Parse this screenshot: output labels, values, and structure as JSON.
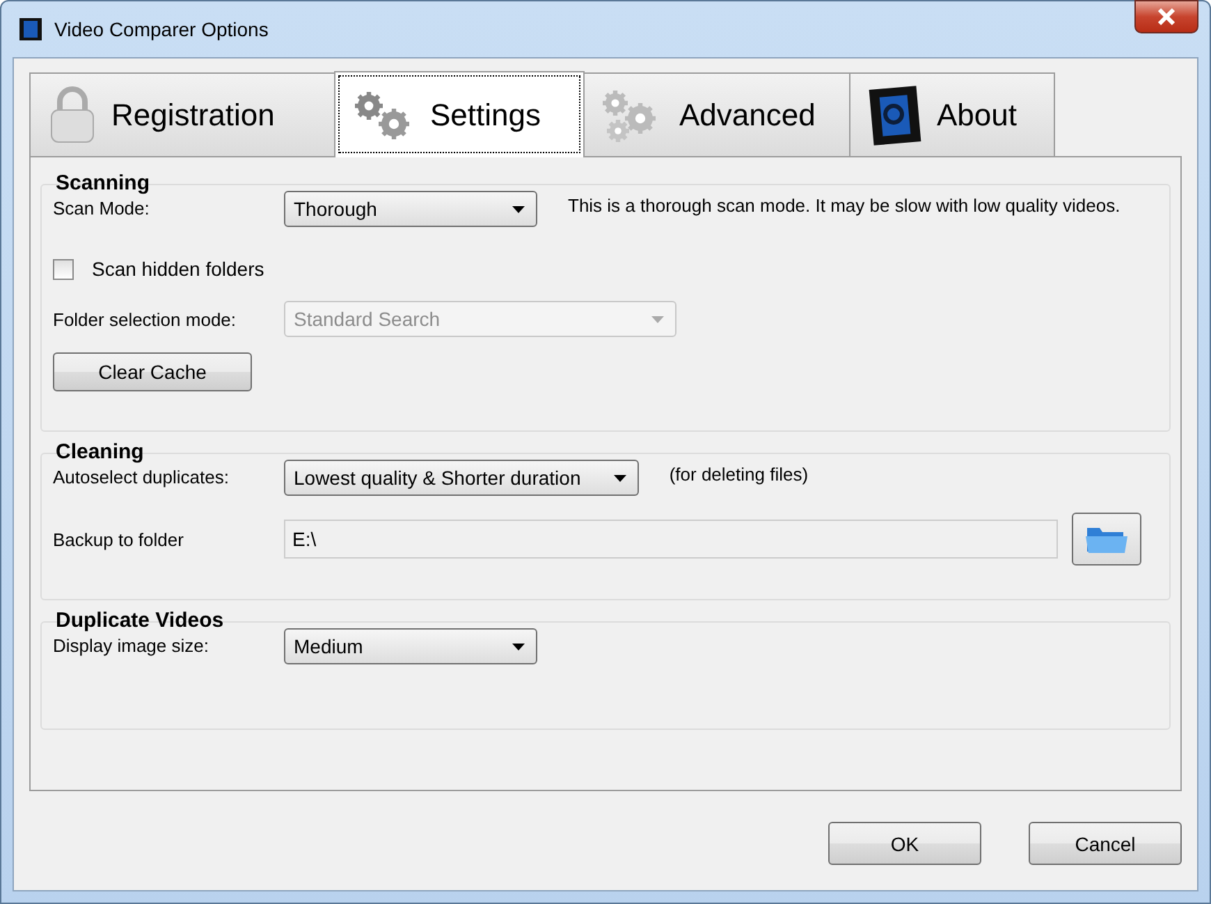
{
  "window": {
    "title": "Video Comparer Options"
  },
  "tabs": [
    {
      "label": "Registration",
      "kind": "lock",
      "selected": false
    },
    {
      "label": "Settings",
      "kind": "gears",
      "selected": true
    },
    {
      "label": "Advanced",
      "kind": "gears-faded",
      "selected": false
    },
    {
      "label": "About",
      "kind": "film",
      "selected": false
    }
  ],
  "groups": [
    {
      "title": "Scanning",
      "rows": [
        {
          "kind": "select",
          "label": "Scan Mode:",
          "value": "Thorough",
          "disabled": false,
          "note": "This is a thorough scan mode. It may be slow with low quality videos."
        },
        {
          "kind": "checkbox",
          "label": "Scan hidden folders",
          "checked": false
        },
        {
          "kind": "select",
          "label": "Folder selection mode:",
          "value": "Standard Search",
          "disabled": true
        },
        {
          "kind": "button",
          "label": "Clear Cache"
        }
      ]
    },
    {
      "title": "Cleaning",
      "rows": [
        {
          "kind": "select",
          "label": "Autoselect duplicates:",
          "value": "Lowest quality & Shorter duration",
          "disabled": false,
          "note": "(for deleting files)"
        },
        {
          "kind": "folder",
          "label": "Backup to folder",
          "value": "E:\\"
        }
      ]
    },
    {
      "title": "Duplicate Videos",
      "rows": [
        {
          "kind": "select",
          "label": "Display image size:",
          "value": "Medium",
          "disabled": false
        }
      ]
    }
  ],
  "buttons": [
    "OK",
    "Cancel"
  ]
}
